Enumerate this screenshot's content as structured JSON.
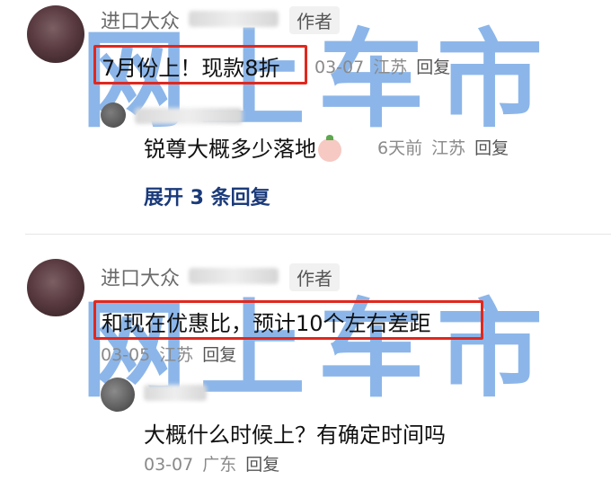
{
  "watermark": {
    "line1": "网上车市",
    "line2": "网上车市"
  },
  "comment1": {
    "username": "进口大众",
    "author_tag": "作者",
    "text": "7月份上！现款8折",
    "meta": {
      "date": "03-07",
      "location": "江苏",
      "reply": "回复"
    },
    "reply": {
      "text": "锐尊大概多少落地",
      "meta": {
        "time": "6天前",
        "location": "江苏",
        "reply": "回复"
      }
    },
    "expand_label": "展开 3 条回复"
  },
  "comment2": {
    "username": "进口大众",
    "author_tag": "作者",
    "text": "和现在优惠比，预计10个左右差距",
    "meta": {
      "date": "03-05",
      "location": "江苏",
      "reply": "回复"
    },
    "reply": {
      "text": "大概什么时候上？有确定时间吗",
      "meta": {
        "date": "03-07",
        "location": "广东",
        "reply": "回复"
      }
    }
  },
  "colors": {
    "highlight": "#e0281e",
    "watermark": "#2f7bd8",
    "expand": "#1a3a7a"
  }
}
